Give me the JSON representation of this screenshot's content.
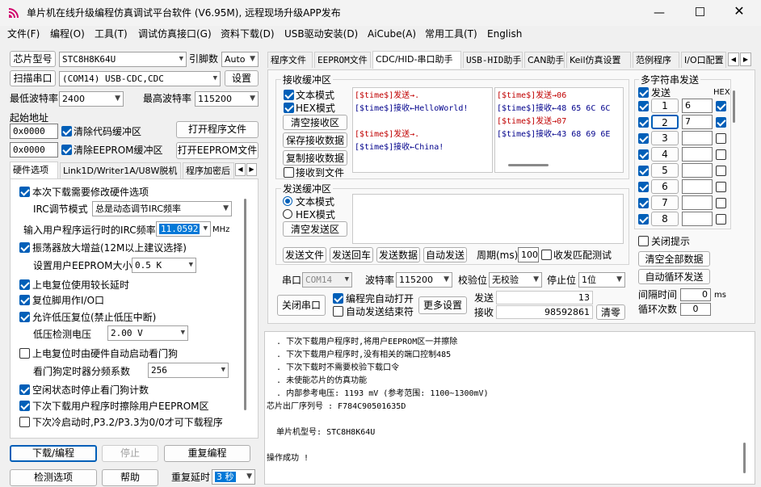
{
  "title": "单片机在线升级编程仿真调试平台软件 (V6.95M), 远程现场升级APP发布",
  "menu": [
    "文件(F)",
    "编程(O)",
    "工具(T)",
    "调试仿真接口(G)",
    "资料下载(D)",
    "USB驱动安装(D)",
    "AiCube(A)",
    "常用工具(T)",
    "English"
  ],
  "left": {
    "chip_label": "芯片型号",
    "chip_value": "STC8H8K64U",
    "pin_label": "引脚数",
    "pin_value": "Auto",
    "scan_btn": "扫描串口",
    "port_value": "(COM14) USB-CDC,CDC",
    "settings_btn": "设置",
    "min_baud_label": "最低波特率",
    "min_baud_value": "2400",
    "max_baud_label": "最高波特率",
    "max_baud_value": "115200",
    "start_addr_label": "起始地址",
    "addr1": "0x0000",
    "clear_code_label": "清除代码缓冲区",
    "open_prog_btn": "打开程序文件",
    "addr2": "0x0000",
    "clear_eeprom_label": "清除EEPROM缓冲区",
    "open_eeprom_btn": "打开EEPROM文件",
    "tabs": [
      "硬件选项",
      "Link1D/Writer1A/U8W脱机",
      "程序加密后"
    ],
    "opt_modify_hw": "本次下载需要修改硬件选项",
    "irc_mode_label": "IRC调节模式",
    "irc_mode_value": "总是动态调节IRC频率",
    "irc_freq_label": "输入用户程序运行时的IRC频率",
    "irc_freq_value": "11.0592",
    "irc_freq_unit": "MHz",
    "opt_osc_gain": "振荡器放大增益(12M以上建议选择)",
    "eeprom_size_label": "设置用户EEPROM大小",
    "eeprom_size_value": "0.5 K",
    "opt_long_reset": "上电复位使用较长延时",
    "opt_reset_io": "复位脚用作I/O口",
    "opt_lvd": "允许低压复位(禁止低压中断)",
    "lvd_label": "低压检测电压",
    "lvd_value": "2.00 V",
    "opt_wdt": "上电复位时由硬件自动启动看门狗",
    "wdt_div_label": "看门狗定时器分频系数",
    "wdt_div_value": "256",
    "opt_idle_wdt": "空闲状态时停止看门狗计数",
    "opt_erase_eeprom": "下次下载用户程序时擦除用户EEPROM区",
    "opt_cold": "下次冷启动时,P3.2/P3.3为0/0才可下载程序",
    "download_btn": "下载/编程",
    "stop_btn": "停止",
    "reprog_btn": "重复编程",
    "check_btn": "检测选项",
    "help_btn": "帮助",
    "repeat_delay_label": "重复延时",
    "repeat_delay_value": "3 秒"
  },
  "right": {
    "tabs": [
      "程序文件",
      "EEPROM文件",
      "CDC/HID-串口助手",
      "USB-HID助手",
      "CAN助手",
      "Keil仿真设置",
      "范例程序",
      "I/O口配置"
    ],
    "rx_label": "接收缓冲区",
    "rx_text_mode": "文本模式",
    "rx_hex_mode": "HEX模式",
    "rx_clear_btn": "清空接收区",
    "rx_save_btn": "保存接收数据",
    "rx_copy_btn": "复制接收数据",
    "rx_to_file": "接收到文件",
    "rx_text_lines": [
      {
        "c": "red",
        "t": "[$time$]发送→."
      },
      {
        "c": "blue",
        "t": "[$time$]接收←HelloWorld!"
      },
      {
        "c": "",
        "t": ""
      },
      {
        "c": "red",
        "t": "[$time$]发送→."
      },
      {
        "c": "blue",
        "t": "[$time$]接收←China!"
      }
    ],
    "rx_hex_lines": [
      {
        "c": "red",
        "t": "[$time$]发送→06"
      },
      {
        "c": "blue",
        "t": "[$time$]接收←48 65 6C 6C"
      },
      {
        "c": "red",
        "t": "[$time$]发送→07"
      },
      {
        "c": "blue",
        "t": "[$time$]接收←43 68 69 6E"
      }
    ],
    "tx_label": "发送缓冲区",
    "tx_text_mode": "文本模式",
    "tx_hex_mode": "HEX模式",
    "tx_clear_btn": "清空发送区",
    "send_file_btn": "发送文件",
    "send_back_btn": "发送回车",
    "send_data_btn": "发送数据",
    "auto_send_btn": "自动发送",
    "period_label": "周期(ms)",
    "period_value": "100",
    "match_label": "收发匹配测试",
    "port_label": "串口",
    "port_value": "COM14",
    "baud_label": "波特率",
    "baud_value": "115200",
    "parity_label": "校验位",
    "parity_value": "无校验",
    "stop_label": "停止位",
    "stop_value": "1位",
    "close_port_btn": "关闭串口",
    "auto_open_label": "编程完自动打开",
    "auto_end_label": "自动发送结束符",
    "more_btn": "更多设置",
    "sent_label": "发送",
    "sent_value": "13",
    "recv_label": "接收",
    "recv_value": "98592861",
    "clear_count_btn": "清零",
    "multi_label": "多字符串发送",
    "multi_send_label": "发送",
    "hex_label": "HEX",
    "multi_rows": [
      {
        "n": "1",
        "v": "6"
      },
      {
        "n": "2",
        "v": "7"
      },
      {
        "n": "3",
        "v": ""
      },
      {
        "n": "4",
        "v": ""
      },
      {
        "n": "5",
        "v": ""
      },
      {
        "n": "6",
        "v": ""
      },
      {
        "n": "7",
        "v": ""
      },
      {
        "n": "8",
        "v": ""
      }
    ],
    "close_hint_label": "关闭提示",
    "clear_all_btn": "清空全部数据",
    "auto_loop_btn": "自动循环发送",
    "interval_label": "间隔时间",
    "interval_value": "0",
    "interval_unit": "ms",
    "loop_label": "循环次数",
    "loop_value": "0"
  },
  "log": {
    "lines": [
      "  . 下次下载用户程序时,将用户EEPROM区一并擦除",
      "  . 下次下载用户程序时,没有相关的端口控制485",
      "  . 下次下载时不需要校验下载口令",
      "  . 未使能芯片的仿真功能",
      "  . 内部参考电压: 1193 mV (参考范围: 1100~1300mV)",
      "芯片出厂序列号 : F784C90501635D",
      "",
      "  单片机型号: STC8H8K64U",
      "",
      "操作成功 !"
    ]
  }
}
